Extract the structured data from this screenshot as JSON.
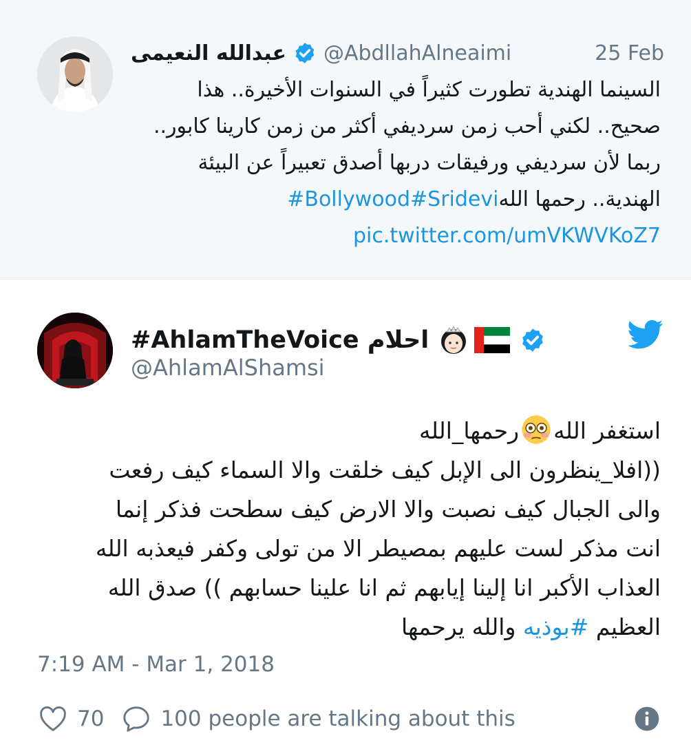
{
  "quoted_tweet": {
    "name": "عبدالله النعيمى",
    "handle": "@AbdllahAlneaimi",
    "date": "25 Feb",
    "lines": [
      "السينما الهندية تطورت كثيراً في السنوات الأخيرة.. هذا",
      "صحيح.. لكني أحب زمن سرديفي أكثر من زمن كارينا كابور..",
      "ربما لأن سرديفي ورفيقات دربها أصدق تعبيراً عن البيئة"
    ],
    "last_line_text": "الهندية.. رحمها الله",
    "hashtags": "#Bollywood#Sridevi",
    "pic_link": "pic.twitter.com/umVKWVKoZ7"
  },
  "main_tweet": {
    "name": "#AhlamTheVoice احلام",
    "handle": "@AhlamAlShamsi",
    "line1_before": "رحمها_الله",
    "line1_after": "استغفر الله",
    "lines": [
      "((افلا_ينظرون الى الإبل كيف خلقت والا السماء كيف رفعت",
      "والى الجبال كيف نصبت والا الارض كيف سطحت فذكر إنما",
      "انت مذكر لست عليهم بمصيطر الا من تولى وكفر فيعذبه الله",
      "العذاب الأكبر انا إلينا إيابهم ثم انا علينا حسابهم )) صدق الله"
    ],
    "last_line_before": "العظيم ",
    "last_line_hashtag": "#بوذيه",
    "last_line_after": " والله يرحمها",
    "timestamp": "7:19 AM - Mar 1, 2018",
    "like_count": "70",
    "talking": "100 people are talking about this"
  },
  "colors": {
    "link": "#1b95e0",
    "verified": "#1da1f2",
    "muted": "#657786"
  }
}
